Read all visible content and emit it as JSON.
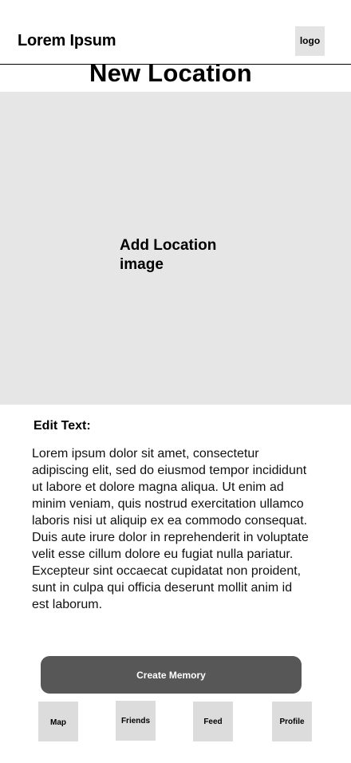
{
  "header": {
    "app_title": "Lorem Ipsum",
    "logo_label": "logo"
  },
  "page": {
    "title": "New Location"
  },
  "image_area": {
    "label": "Add Location\nimage"
  },
  "editor": {
    "label": "Edit Text:",
    "text": "Lorem ipsum dolor sit amet, consectetur adipiscing elit, sed do eiusmod tempor incididunt ut labore et dolore magna aliqua. Ut enim ad minim veniam, quis nostrud exercitation ullamco laboris nisi ut aliquip ex ea commodo consequat. Duis aute irure dolor in reprehenderit in voluptate velit esse cillum dolore eu fugiat nulla pariatur. Excepteur sint occaecat cupidatat non proident, sunt in culpa qui officia deserunt mollit anim id est laborum."
  },
  "actions": {
    "create_label": "Create Memory"
  },
  "nav": {
    "items": [
      {
        "label": "Map"
      },
      {
        "label": "Friends"
      },
      {
        "label": "Feed"
      },
      {
        "label": "Profile"
      }
    ]
  },
  "colors": {
    "image_placeholder": "#e6e6e6",
    "primary_button": "#575757",
    "nav_tile": "#dcdcdc",
    "logo_tile": "#e3e3e3"
  }
}
